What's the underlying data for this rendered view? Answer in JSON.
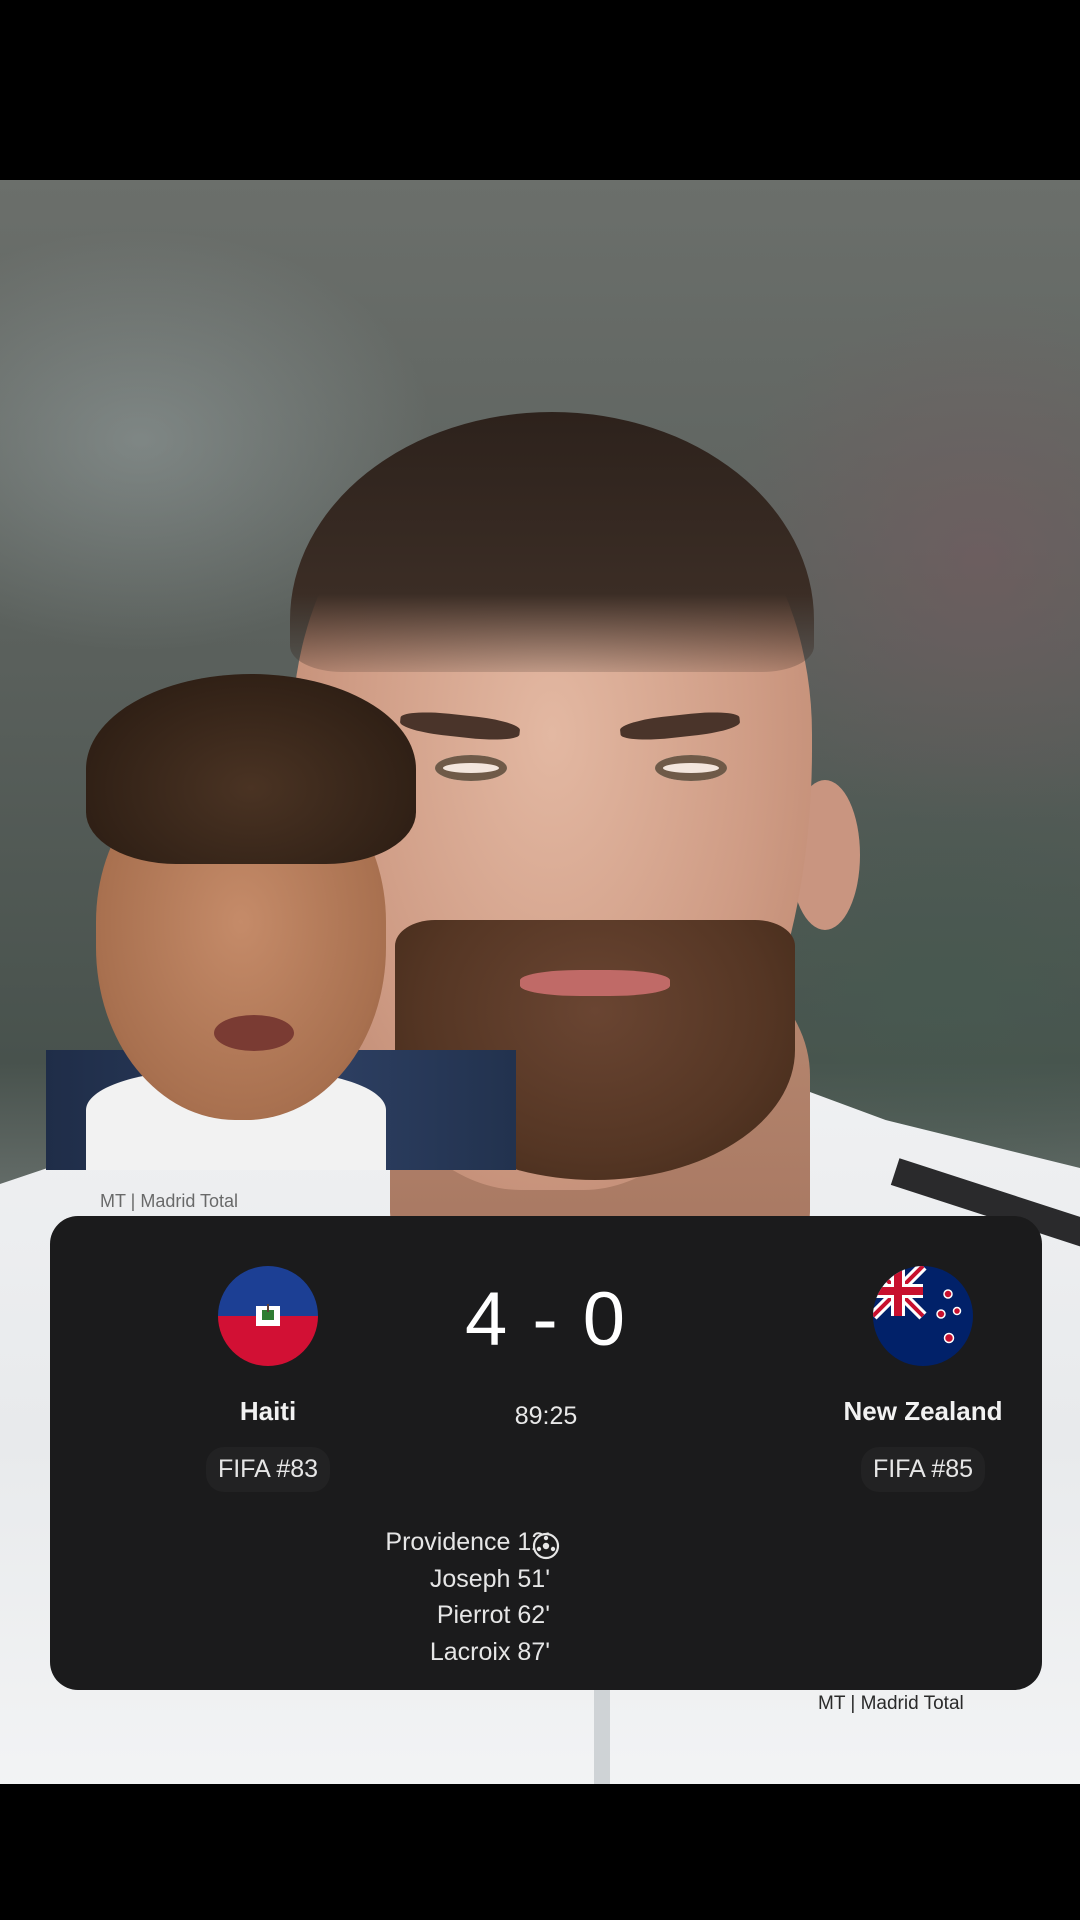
{
  "watermark": {
    "top": "MT | Madrid Total",
    "bottom": "MT | Madrid Total"
  },
  "match": {
    "home": {
      "name": "Haiti",
      "rank": "FIFA #83",
      "flag": "haiti-flag-icon"
    },
    "away": {
      "name": "New Zealand",
      "rank": "FIFA #85",
      "flag": "new-zealand-flag-icon"
    },
    "score": "4 - 0",
    "clock": "89:25",
    "scorers": [
      "Providence 12'",
      "Joseph 51'",
      "Pierrot 62'",
      "Lacroix 87'"
    ],
    "goal_icon": "soccer-ball-icon"
  },
  "colors": {
    "card_bg": "#1b1b1c",
    "haiti_blue": "#1c3f94",
    "haiti_red": "#d21034",
    "nz_blue": "#012169",
    "nz_red": "#c8102e"
  }
}
